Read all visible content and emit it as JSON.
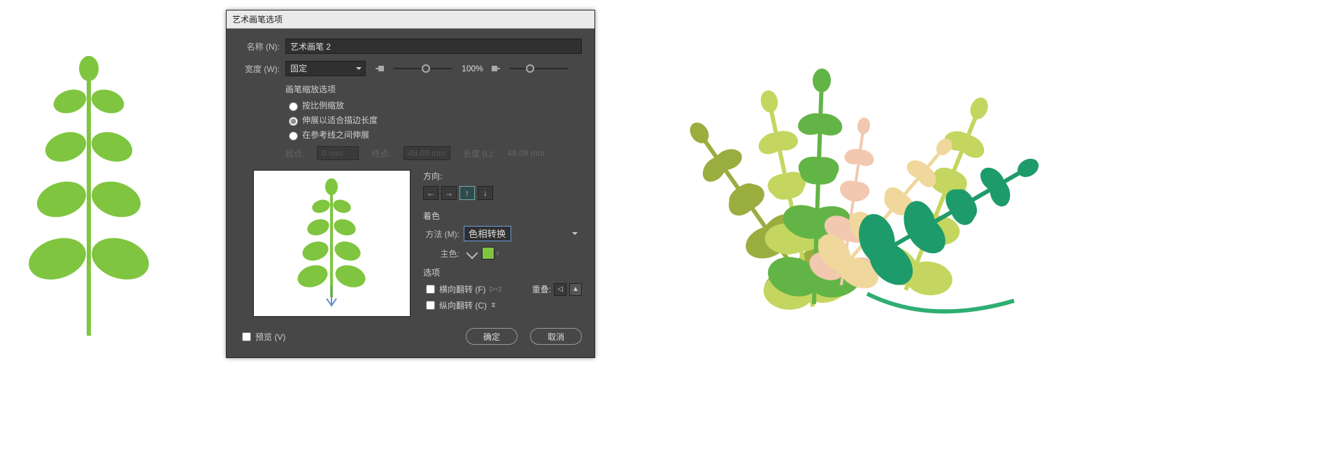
{
  "dialog": {
    "title": "艺术画笔选项",
    "name_label": "名称 (N):",
    "name_value": "艺术画笔 2",
    "width_label": "宽度 (W):",
    "width_mode": "固定",
    "width_percent": "100%",
    "scale_section": "画笔缩放选项",
    "scale_options": {
      "proportional": "按比例缩放",
      "stretch_fit": "伸展以适合描边长度",
      "stretch_guides": "在参考线之间伸展"
    },
    "scale_selected": "stretch_fit",
    "disabled": {
      "start_label": "起点:",
      "start_val": "0 mm",
      "end_label": "终点:",
      "end_val": "48.09 mm",
      "length_label": "长度 (L):",
      "length_val": "48.09 mm"
    },
    "direction_label": "方向:",
    "colorize_label": "着色",
    "method_label": "方法 (M):",
    "method_value": "色相转换",
    "keycolor_label": "主色:",
    "keycolor_hex": "#7fc540",
    "options_label": "选项",
    "flip_h": "横向翻转 (F)",
    "flip_v": "纵向翻转 (C)",
    "overlap_label": "重叠:",
    "preview_label": "预览 (V)",
    "ok": "确定",
    "cancel": "取消"
  },
  "icons": {
    "dir_left": "←",
    "dir_right": "→",
    "dir_up": "↑",
    "dir_down": "↓",
    "tip": "♀",
    "flip_h_glyph": "▷◁",
    "flip_v_glyph": "⧗",
    "overlap_a": "◁",
    "overlap_b": "▲"
  },
  "plants": {
    "green": "#7fc540",
    "dkgreen": "#5aa63e",
    "olive": "#9aad3f",
    "lime": "#c4d65f",
    "peach": "#f2c8b0",
    "cream": "#f0d79c",
    "teal": "#2eae73",
    "teal2": "#1e9b6a"
  }
}
